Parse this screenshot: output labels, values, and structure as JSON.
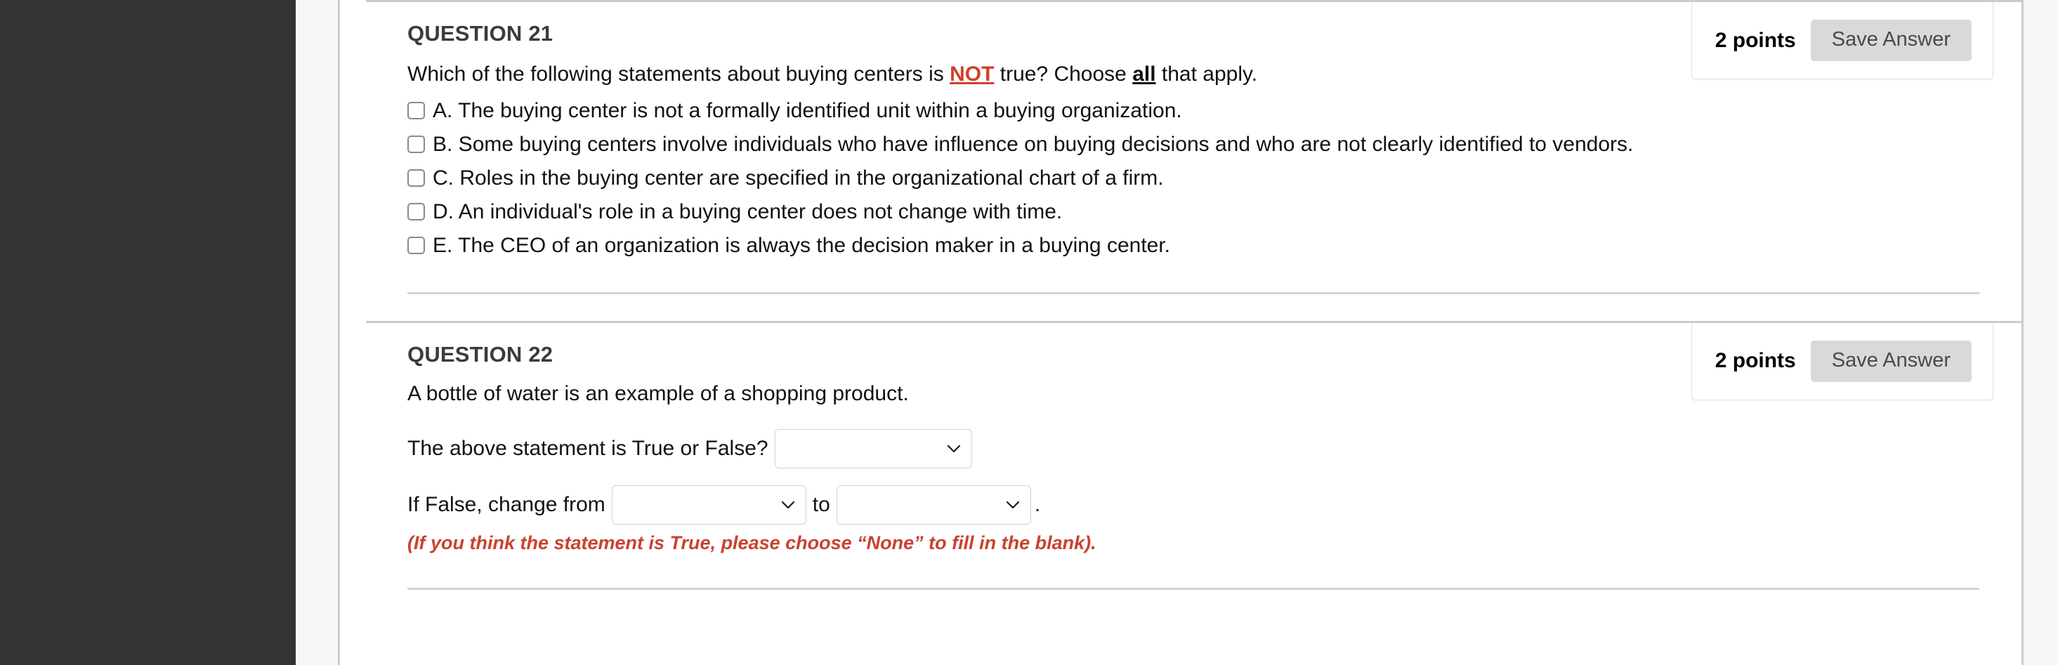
{
  "layout": {
    "nav_rail_color": "#333333",
    "gutter_color": "#f7f7f7",
    "divider_color": "#cccccc",
    "accent_red": "#d0412e",
    "save_button_bg": "#d9d9d9"
  },
  "questions": [
    {
      "title": "QUESTION 21",
      "points_label": "2 points",
      "save_label": "Save Answer",
      "prompt": {
        "part1": "Which of the following statements about buying centers is ",
        "emphasis_red": "NOT",
        "part2": " true?  Choose ",
        "emphasis_bold": "all",
        "part3": " that apply."
      },
      "options": [
        {
          "text": "A. The buying center is not a formally identified unit within a buying organization."
        },
        {
          "text": "B. Some buying centers involve individuals who have influence on buying decisions and who are not clearly identified to vendors."
        },
        {
          "text": "C. Roles in the buying center are specified in the organizational chart of a firm."
        },
        {
          "text": "D. An individual's role in a buying center does not change with time."
        },
        {
          "text": "E. The CEO of an organization is always the decision maker in a buying center."
        }
      ]
    },
    {
      "title": "QUESTION 22",
      "points_label": "2 points",
      "save_label": "Save Answer",
      "statement": "A bottle of water is an example of a shopping product.",
      "true_false_label": "The above statement is True or False?",
      "true_false_value": "",
      "change_from_label": "If False, change from",
      "change_from_value": "",
      "to_label": "to",
      "change_to_value": "",
      "trailing_period": ".",
      "hint": "(If you think the statement is True, please choose “None” to fill in the blank)."
    }
  ]
}
